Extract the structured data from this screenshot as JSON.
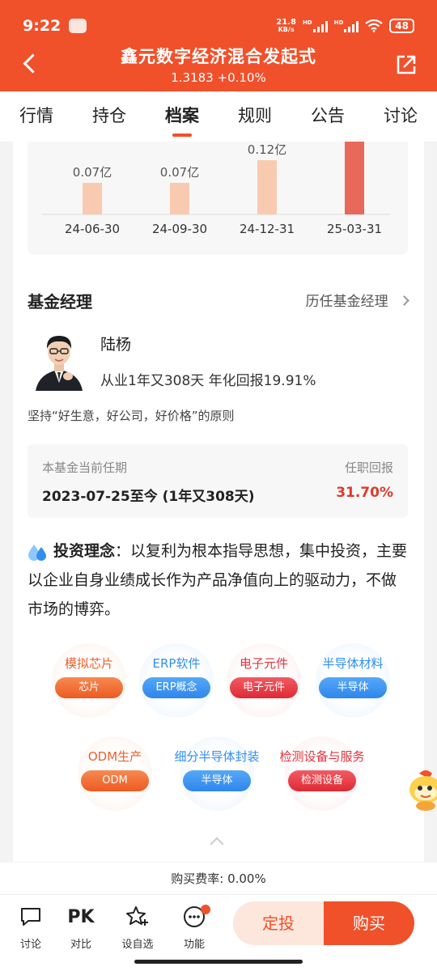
{
  "status_bar": {
    "time": "9:22",
    "net_speed_top": "21.8",
    "net_speed_bottom": "KB/s",
    "hd1": "HD",
    "hd2": "HD",
    "battery": "48"
  },
  "header": {
    "title": "鑫元数字经济混合发起式",
    "subtitle": "1.3183 +0.10%"
  },
  "tabs": [
    {
      "label": "行情",
      "active": false
    },
    {
      "label": "持仓",
      "active": false
    },
    {
      "label": "档案",
      "active": true
    },
    {
      "label": "规则",
      "active": false
    },
    {
      "label": "公告",
      "active": false
    },
    {
      "label": "讨论",
      "active": false
    }
  ],
  "chart_data": {
    "type": "bar",
    "categories": [
      "24-06-30",
      "24-09-30",
      "24-12-31",
      "25-03-31"
    ],
    "values": [
      0.07,
      0.07,
      0.12,
      null
    ],
    "data_labels": [
      "0.07亿",
      "0.07亿",
      "0.12亿",
      ""
    ],
    "colors": [
      "#f8cbb0",
      "#f8cbb0",
      "#f8cbb0",
      "#e8695a"
    ],
    "title": "",
    "xlabel": "",
    "ylabel": ""
  },
  "manager": {
    "section_title": "基金经理",
    "history_link": "历任基金经理",
    "name": "陆杨",
    "info": "从业1年又308天 年化回报19.91%",
    "motto": "坚持“好生意，好公司，好价格”的原则"
  },
  "tenure": {
    "label": "本基金当前任期",
    "value": "2023-07-25至今 (1年又308天)",
    "return_label": "任职回报",
    "return_value": "31.70%"
  },
  "philosophy": {
    "label": "投资理念",
    "text": "：以复利为根本指导思想，集中投资，主要以企业自身业绩成长作为产品净值向上的驱动力，不做市场的博弈。"
  },
  "concepts": [
    {
      "title": "模拟芯片",
      "tag": "芯片",
      "color": "orange"
    },
    {
      "title": "ERP软件",
      "tag": "ERP概念",
      "color": "blue"
    },
    {
      "title": "电子元件",
      "tag": "电子元件",
      "color": "red"
    },
    {
      "title": "半导体材料",
      "tag": "半导体",
      "color": "blue"
    },
    {
      "title": "ODM生产",
      "tag": "ODM",
      "color": "orange"
    },
    {
      "title": "细分半导体封装",
      "tag": "半导体",
      "color": "blue"
    },
    {
      "title": "检测设备与服务",
      "tag": "检测设备",
      "color": "red"
    }
  ],
  "fee": "购买费率: 0.00%",
  "bottom_nav": {
    "discuss": "讨论",
    "compare_icon_text": "PK",
    "compare": "对比",
    "watch": "设自选",
    "functions": "功能",
    "auto_invest": "定投",
    "buy": "购买"
  }
}
